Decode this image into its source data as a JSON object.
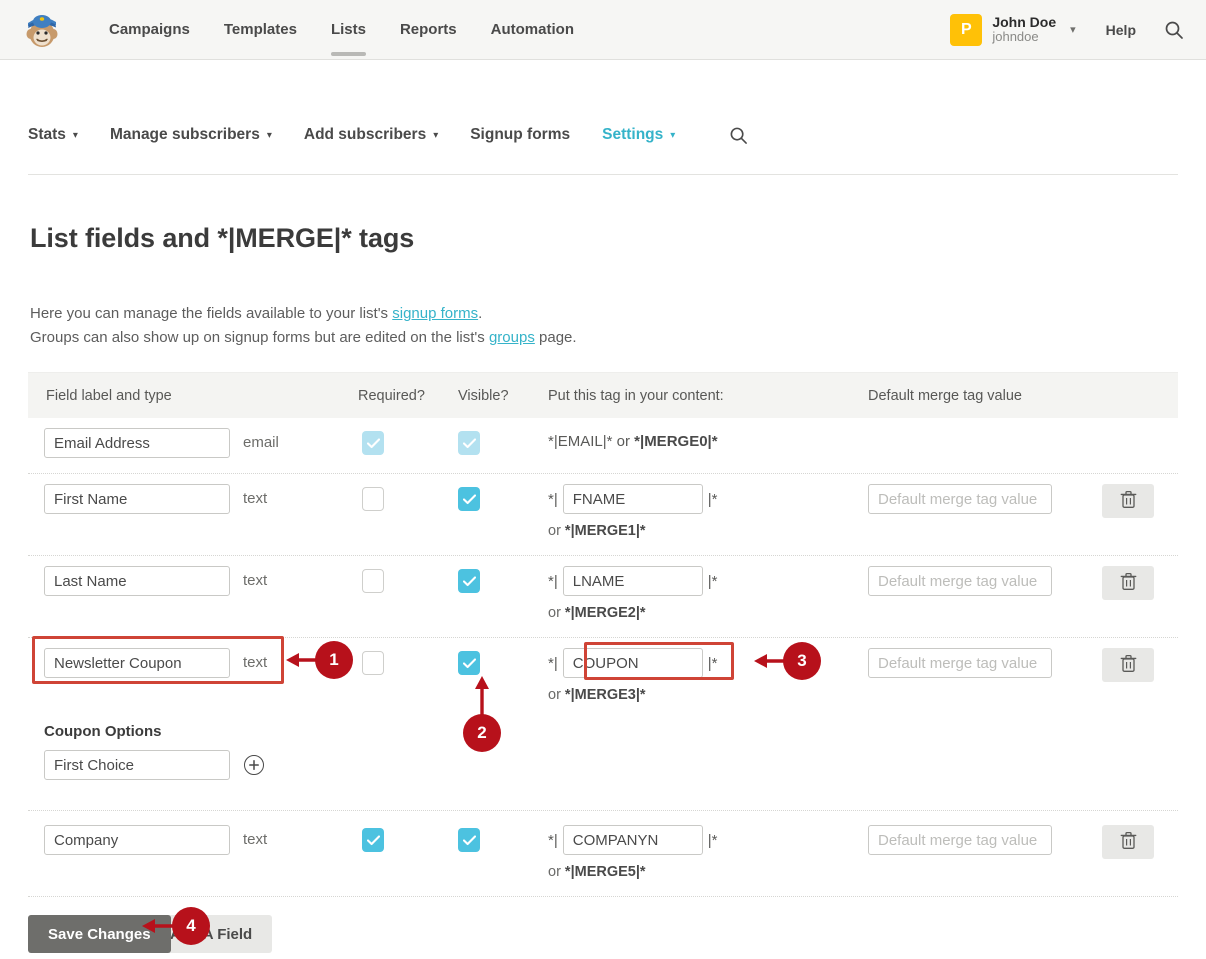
{
  "header": {
    "logo_icon": "mailchimp-freddie-logo",
    "menu": [
      {
        "label": "Campaigns",
        "active": false
      },
      {
        "label": "Templates",
        "active": false
      },
      {
        "label": "Lists",
        "active": true
      },
      {
        "label": "Reports",
        "active": false
      },
      {
        "label": "Automation",
        "active": false
      }
    ],
    "avatar_initial": "P",
    "avatar_color": "#ffc107",
    "user_name": "John Doe",
    "user_handle": "johndoe",
    "caret_icon": "chevron-down-icon",
    "help_label": "Help",
    "search_icon": "search-icon"
  },
  "subnav": {
    "items": [
      {
        "label": "Stats",
        "caret": true,
        "active": false
      },
      {
        "label": "Manage subscribers",
        "caret": true,
        "active": false
      },
      {
        "label": "Add subscribers",
        "caret": true,
        "active": false
      },
      {
        "label": "Signup forms",
        "caret": false,
        "active": false
      },
      {
        "label": "Settings",
        "caret": true,
        "active": true
      }
    ],
    "search_icon": "search-icon",
    "active_color": "#35b3c9"
  },
  "page": {
    "title": "List fields and *|MERGE|* tags",
    "intro_line1_pre": "Here you can manage the fields available to your list's ",
    "intro_link1": "signup forms",
    "intro_line1_post": ".",
    "intro_line2_pre": "Groups can also show up on signup forms but are edited on the list's ",
    "intro_link2": "groups",
    "intro_line2_post": " page."
  },
  "table": {
    "headers": {
      "field": "Field label and type",
      "required": "Required?",
      "visible": "Visible?",
      "tag": "Put this tag in your content:",
      "default": "Default merge tag value"
    },
    "default_placeholder": "Default merge tag value",
    "delete_icon": "trash-icon",
    "rows": [
      {
        "name": "Email Address",
        "type": "email",
        "required": "dim",
        "visible": "dim",
        "tag_static": "*|EMAIL|* or ",
        "tag_static_bold": "*|MERGE0|*",
        "tag_input": null,
        "alt_tag": null,
        "has_default": false,
        "has_delete": false
      },
      {
        "name": "First Name",
        "type": "text",
        "required": "off",
        "visible": "on",
        "tag_input": "FNAME",
        "alt_tag_prefix": "or ",
        "alt_tag": "*|MERGE1|*",
        "has_default": true,
        "has_delete": true
      },
      {
        "name": "Last Name",
        "type": "text",
        "required": "off",
        "visible": "on",
        "tag_input": "LNAME",
        "alt_tag_prefix": "or ",
        "alt_tag": "*|MERGE2|*",
        "has_default": true,
        "has_delete": true
      },
      {
        "name": "Newsletter Coupon",
        "type": "text",
        "required": "off",
        "visible": "on",
        "tag_input": "COUPON",
        "alt_tag_prefix": "or ",
        "alt_tag": "*|MERGE3|*",
        "has_default": true,
        "has_delete": true
      },
      {
        "name": "Company",
        "type": "text",
        "required": "on",
        "visible": "on",
        "tag_input": "COMPANYN",
        "alt_tag_prefix": "or ",
        "alt_tag": "*|MERGE5|*",
        "has_default": true,
        "has_delete": true
      }
    ]
  },
  "coupon_options": {
    "title": "Coupon Options",
    "first_option": "First Choice",
    "add_icon": "plus-circle-icon"
  },
  "buttons": {
    "save": "Save Changes",
    "add_field": "Add A Field"
  },
  "annotations": {
    "color": "#b7111b",
    "box_color": "#cf4436",
    "badges": [
      {
        "number": "1"
      },
      {
        "number": "2"
      },
      {
        "number": "3"
      },
      {
        "number": "4"
      }
    ]
  }
}
